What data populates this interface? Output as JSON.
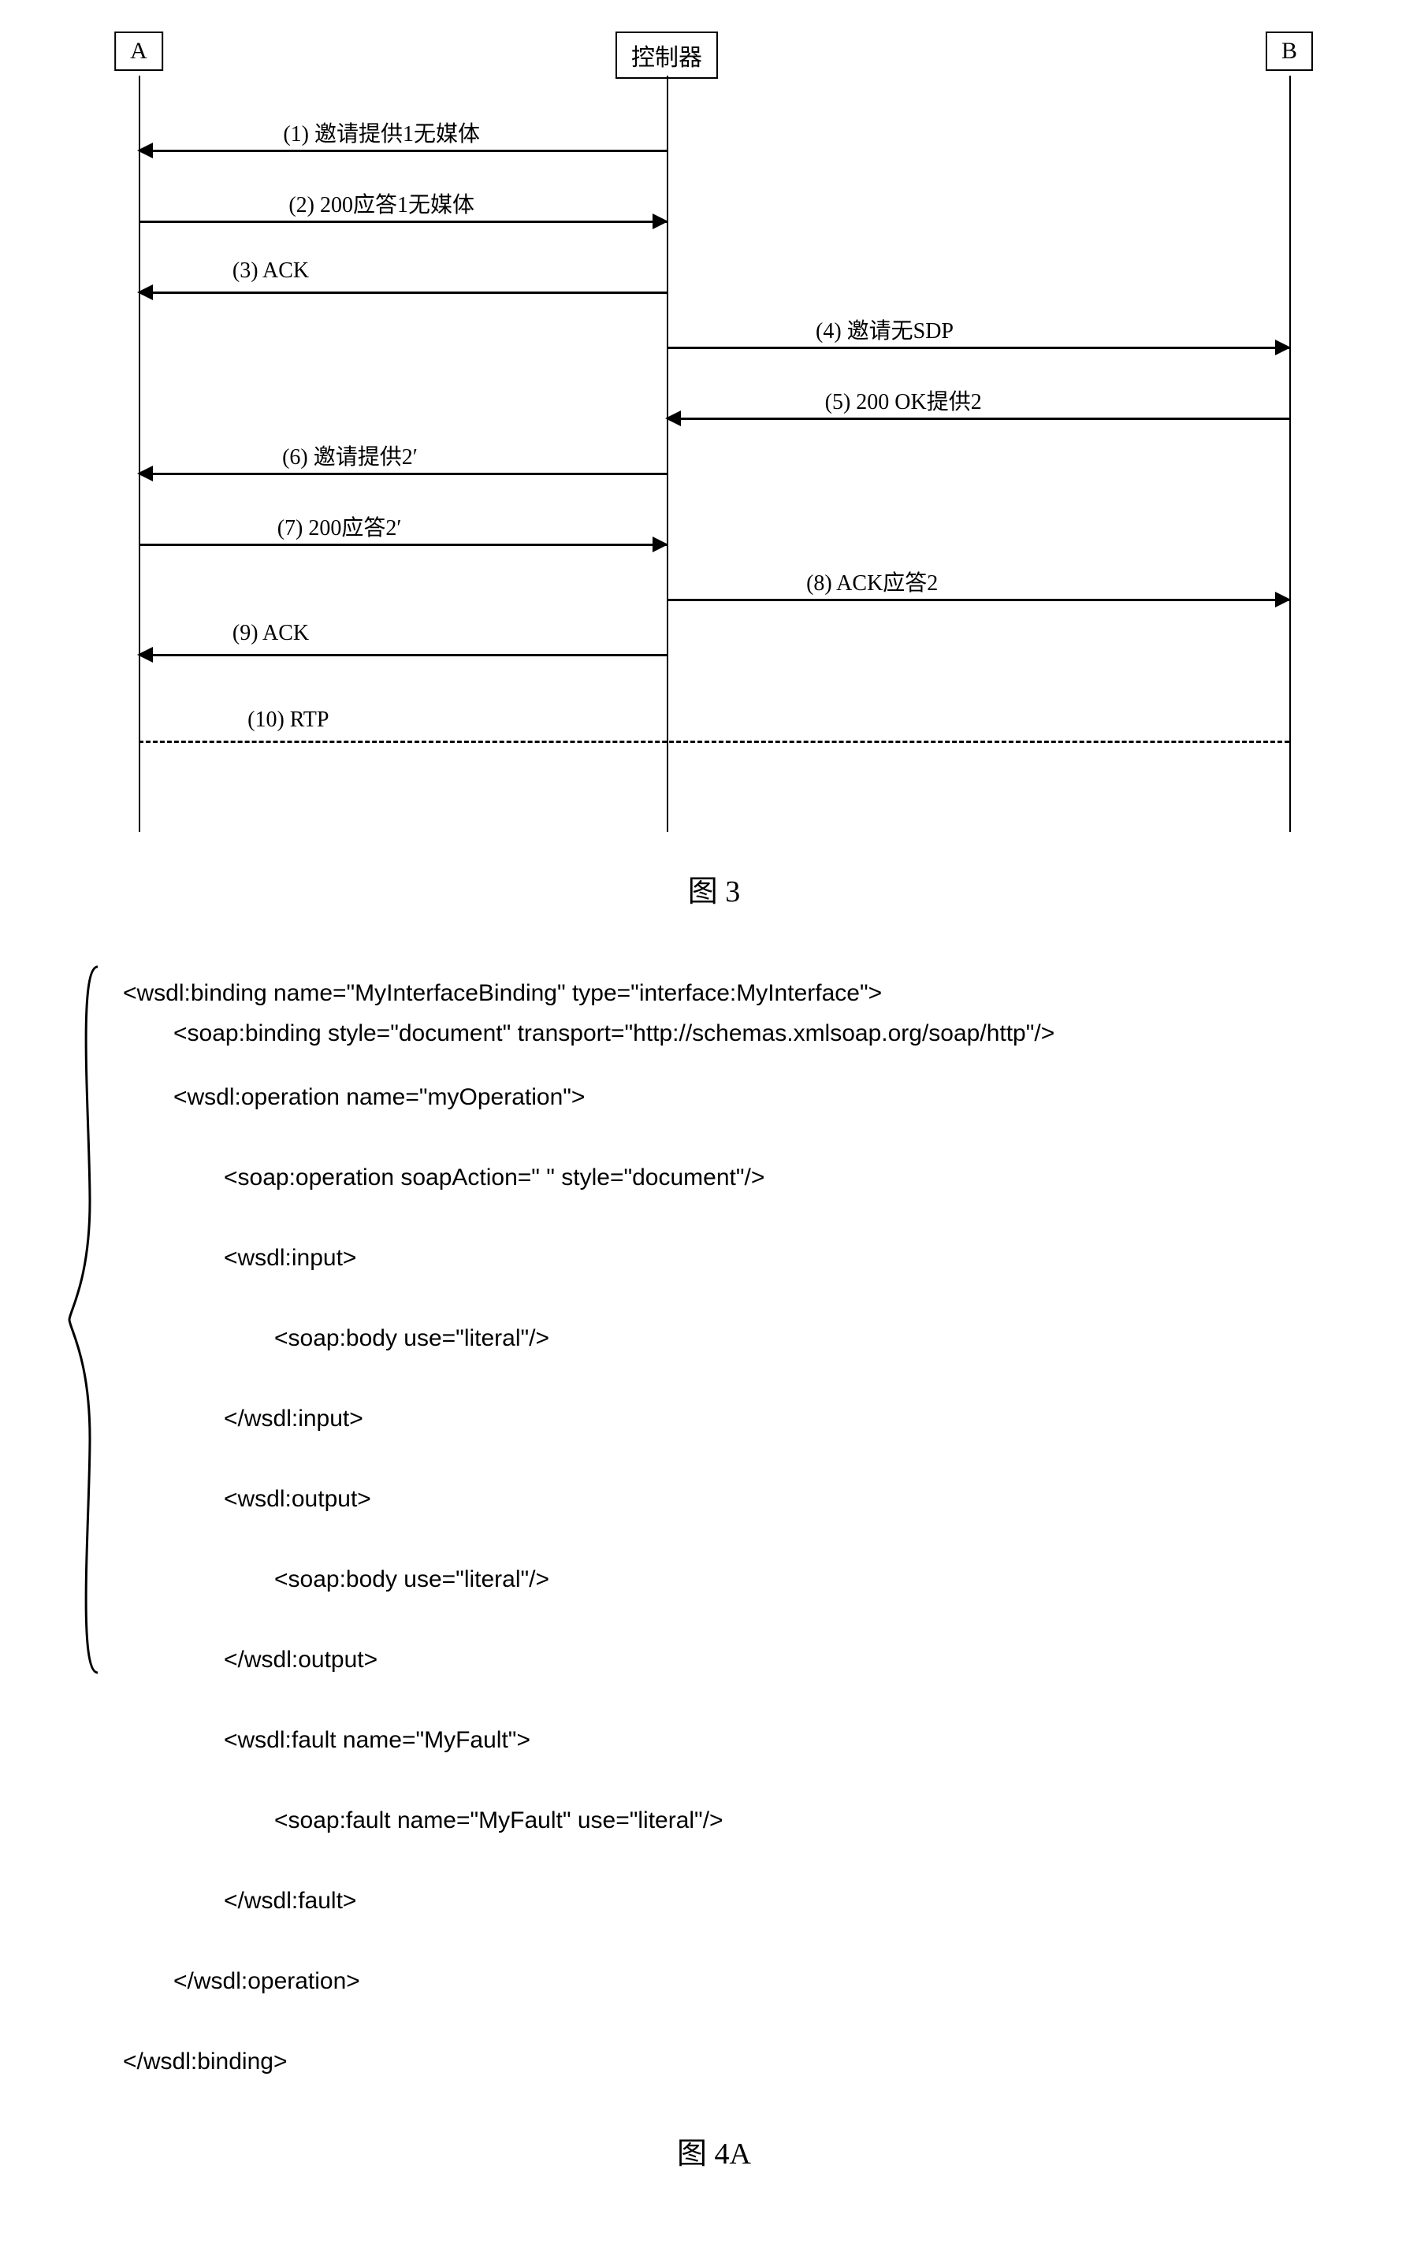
{
  "fig3": {
    "caption": "图  3",
    "participants": {
      "a": "A",
      "controller": "控制器",
      "b": "B"
    },
    "messages": {
      "m1": "(1) 邀请提供1无媒体",
      "m2": "(2) 200应答1无媒体",
      "m3": "(3) ACK",
      "m4": "(4) 邀请无SDP",
      "m5": "(5) 200 OK提供2",
      "m6": "(6) 邀请提供2′",
      "m7": "(7) 200应答2′",
      "m8": "(8) ACK应答2",
      "m9": "(9) ACK",
      "m10": "(10) RTP"
    }
  },
  "fig4a": {
    "caption": "图  4A",
    "code": {
      "l1": "<wsdl:binding name=\"MyInterfaceBinding\" type=\"interface:MyInterface\">",
      "l2": "<soap:binding style=\"document\" transport=\"http://schemas.xmlsoap.org/soap/http\"/>",
      "l3": "<wsdl:operation name=\"myOperation\">",
      "l4": "<soap:operation soapAction=\" \" style=\"document\"/>",
      "l5": "<wsdl:input>",
      "l6": "<soap:body use=\"literal\"/>",
      "l7": "</wsdl:input>",
      "l8": "<wsdl:output>",
      "l9": "<soap:body use=\"literal\"/>",
      "l10": "</wsdl:output>",
      "l11": "<wsdl:fault name=\"MyFault\">",
      "l12": "<soap:fault name=\"MyFault\" use=\"literal\"/>",
      "l13": "</wsdl:fault>",
      "l14": "</wsdl:operation>",
      "l15": "</wsdl:binding>"
    }
  }
}
